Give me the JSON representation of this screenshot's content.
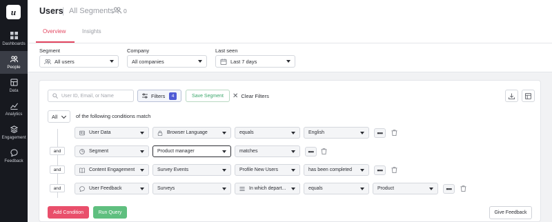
{
  "app": {
    "logo_letter": "u"
  },
  "sidebar": {
    "items": [
      {
        "label": "Dashboards",
        "icon": "dashboard-icon"
      },
      {
        "label": "People",
        "icon": "people-icon",
        "active": true
      },
      {
        "label": "Data",
        "icon": "data-icon"
      },
      {
        "label": "Analytics",
        "icon": "analytics-icon"
      },
      {
        "label": "Engagement",
        "icon": "engagement-icon"
      },
      {
        "label": "Feedback",
        "icon": "feedback-icon"
      }
    ]
  },
  "header": {
    "title": "Users",
    "separator": "|",
    "segment_name": "All Segments",
    "segment_count": "0",
    "tabs": [
      {
        "label": "Overview",
        "active": true
      },
      {
        "label": "Insights",
        "active": false
      }
    ]
  },
  "filters": {
    "segment": {
      "label": "Segment",
      "value": "All users"
    },
    "company": {
      "label": "Company",
      "value": "All companies"
    },
    "last_seen": {
      "label": "Last seen",
      "value": "Last 7 days"
    }
  },
  "query": {
    "search_placeholder": "User ID, Email, or Name",
    "filters_label": "Filters",
    "filters_count": "4",
    "save_segment": "Save Segment",
    "clear_filters": "Clear Filters",
    "match_mode": "All",
    "match_text": "of the following conditions match",
    "connector": "and",
    "conditions": [
      {
        "category": "User Data",
        "field": "Browser Language",
        "operator": "equals",
        "value": "English"
      },
      {
        "category": "Segment",
        "field": "Product manager",
        "operator": "matches"
      },
      {
        "category": "Content Engagement",
        "field": "Survey Events",
        "subfield": "Profile New Users",
        "operator": "has been completed"
      },
      {
        "category": "User Feedback",
        "field": "Surveys",
        "subfield": "In which depart...",
        "operator": "equals",
        "value": "Product"
      }
    ],
    "add_condition": "Add Condition",
    "run_query": "Run Query",
    "give_feedback": "Give Feedback"
  },
  "colors": {
    "accent": "#e3455f",
    "sidebar_bg": "#17191f",
    "primary_button": "#e94f6b",
    "run_button": "#5fbf7f",
    "badge": "#4f5bd5"
  }
}
